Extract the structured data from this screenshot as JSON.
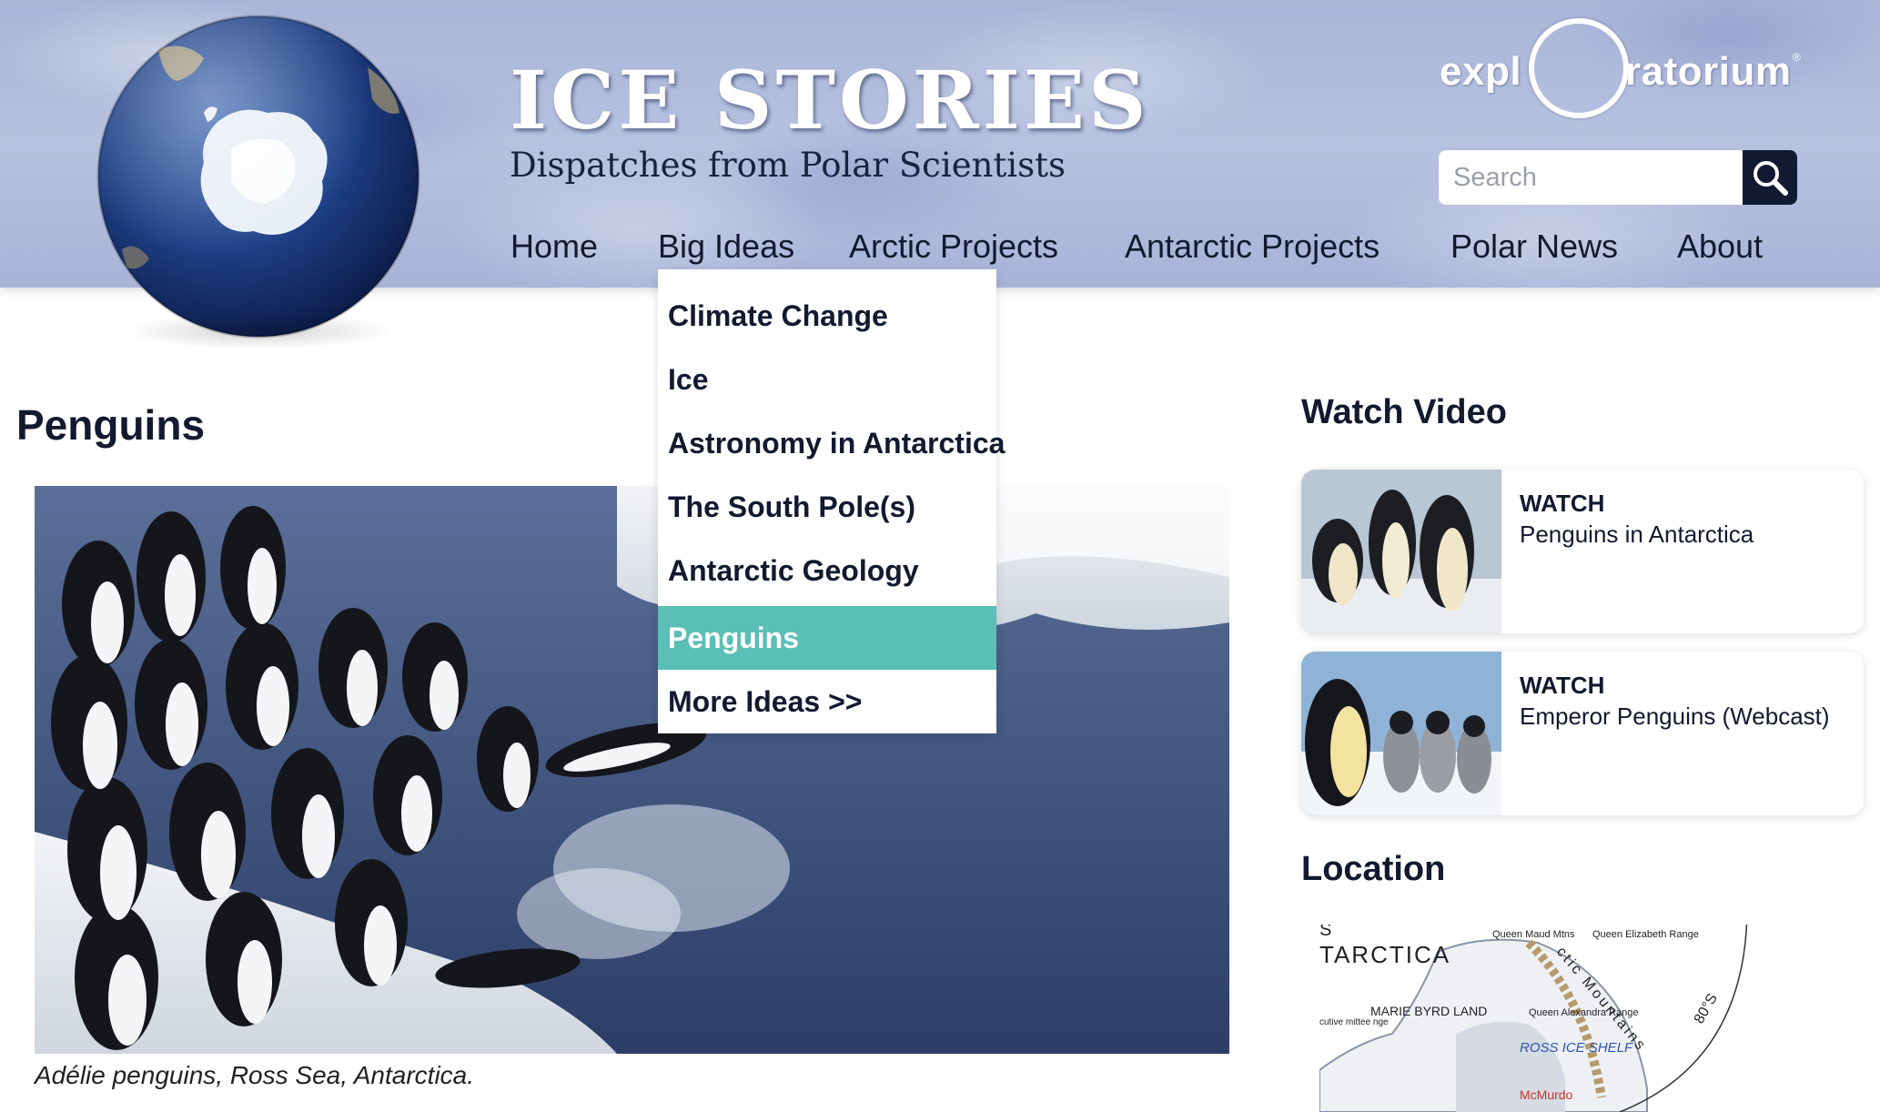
{
  "header": {
    "title": "ICE STORIES",
    "subtitle": "Dispatches from Polar Scientists",
    "logo_left": "expl",
    "logo_right": "ratorium",
    "logo_reg": "®"
  },
  "search": {
    "placeholder": "Search",
    "value": ""
  },
  "nav": {
    "items": [
      {
        "label": "Home"
      },
      {
        "label": "Big Ideas"
      },
      {
        "label": "Arctic Projects"
      },
      {
        "label": "Antarctic Projects"
      },
      {
        "label": "Polar News"
      },
      {
        "label": "About"
      }
    ]
  },
  "dropdown": {
    "items": [
      {
        "label": "Climate Change"
      },
      {
        "label": "Ice"
      },
      {
        "label": "Astronomy in Antarctica"
      },
      {
        "label": "The South Pole(s)"
      },
      {
        "label": "Antarctic Geology"
      },
      {
        "label": "Penguins",
        "active": true
      },
      {
        "label": "More Ideas >>"
      }
    ]
  },
  "main": {
    "title": "Penguins",
    "caption": "Adélie penguins, Ross Sea, Antarctica."
  },
  "sidebar": {
    "video_heading": "Watch Video",
    "videos": [
      {
        "watch": "WATCH",
        "title": "Penguins in Antarctica"
      },
      {
        "watch": "WATCH",
        "title": "Emperor Penguins (Webcast)"
      }
    ],
    "location_heading": "Location",
    "map_labels": {
      "s": "S",
      "antarctica": "TARCTICA",
      "queen_maud": "Queen Maud Mtns",
      "queen_elizabeth": "Queen Elizabeth Range",
      "marie_byrd": "MARIE BYRD LAND",
      "queen_alexandra": "Queen Alexandra Range",
      "ross_ice_shelf": "ROSS ICE SHELF",
      "mcmurdo": "McMurdo",
      "transantarctic": "ctic Mountains",
      "latitude": "80°S",
      "executive": "cutive mittee nge"
    }
  },
  "colors": {
    "accent_teal": "#5bbfb5",
    "navy": "#13192f",
    "header_blue": "#a9b5d8"
  }
}
